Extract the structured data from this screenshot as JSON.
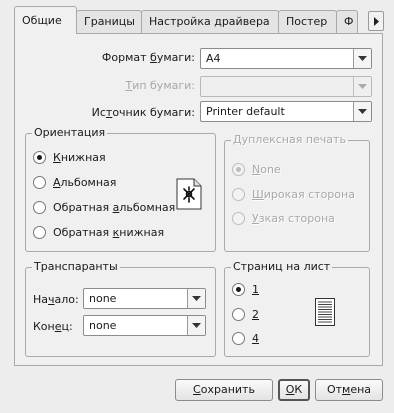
{
  "tabs": [
    {
      "label": "Общие"
    },
    {
      "label": "Границы"
    },
    {
      "label": "Настройка драйвера"
    },
    {
      "label": "Постер"
    },
    {
      "label": "Ф"
    }
  ],
  "fields": {
    "paper_format": {
      "pre": "Формат ",
      "u": "б",
      "post": "умаги:",
      "value": "A4"
    },
    "paper_type": {
      "pre": "",
      "u": "Т",
      "post": "ип бумаги:",
      "value": ""
    },
    "paper_source": {
      "pre": "Ис",
      "u": "т",
      "post": "очник бумаги:",
      "value": "Printer default"
    }
  },
  "orientation": {
    "title": "Ориентация",
    "options": [
      {
        "pre": "",
        "u": "К",
        "post": "нижная",
        "checked": true
      },
      {
        "pre": "",
        "u": "А",
        "post": "льбомная",
        "checked": false
      },
      {
        "pre": "Обратная ",
        "u": "а",
        "post": "льбомная",
        "checked": false
      },
      {
        "pre": "Обратная ",
        "u": "к",
        "post": "нижная",
        "checked": false
      }
    ]
  },
  "duplex": {
    "title": "Дуплексная печать",
    "options": [
      {
        "pre": "",
        "u": "N",
        "post": "one",
        "checked": true
      },
      {
        "pre": "",
        "u": "Ш",
        "post": "ирокая сторона",
        "checked": false
      },
      {
        "pre": "",
        "u": "У",
        "post": "зкая сторона",
        "checked": false
      }
    ]
  },
  "banners": {
    "title": "Транспаранты",
    "start": {
      "pre": "На",
      "u": "ч",
      "post": "ало:",
      "value": "none"
    },
    "end": {
      "pre": "Кон",
      "u": "е",
      "post": "ц:",
      "value": "none"
    }
  },
  "pages_per_sheet": {
    "title": "Страниц на лист",
    "options": [
      {
        "u": "1",
        "checked": true
      },
      {
        "u": "2",
        "checked": false
      },
      {
        "u": "4",
        "checked": false
      }
    ]
  },
  "buttons": {
    "save": {
      "pre": "",
      "u": "С",
      "post": "охранить"
    },
    "ok": {
      "pre": "",
      "u": "О",
      "post": "К"
    },
    "cancel": {
      "pre": "От",
      "u": "м",
      "post": "ена"
    }
  },
  "icons": {
    "portrait_preview": "portrait-page-icon",
    "pages_preview": "single-page-icon",
    "tab_next": "arrow-right-icon",
    "dropdown": "chevron-down-icon"
  }
}
